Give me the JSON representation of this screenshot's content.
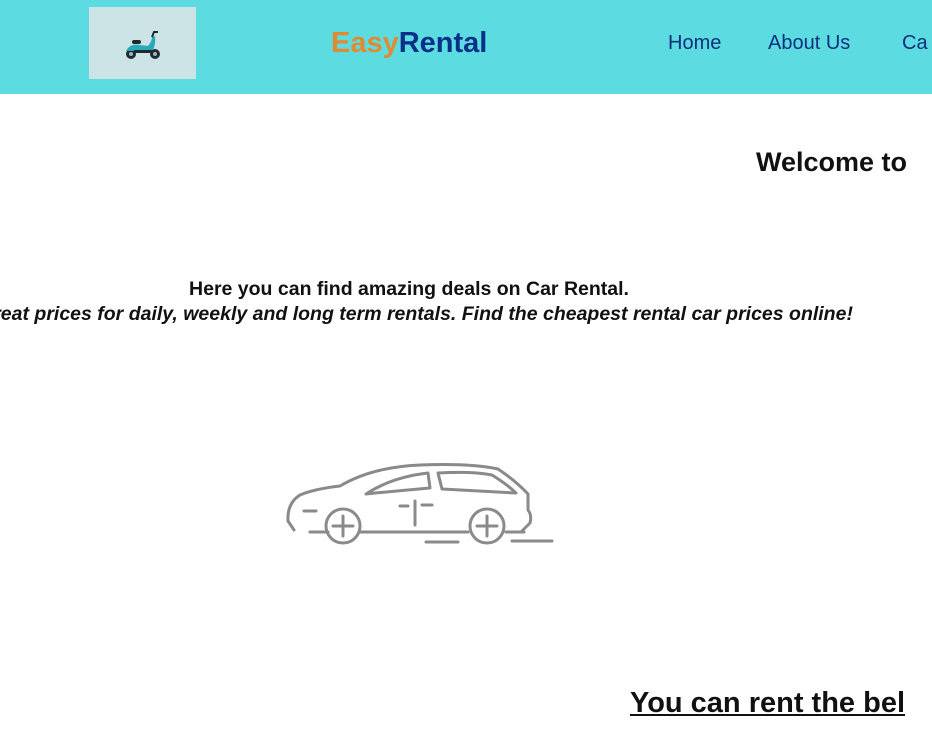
{
  "header": {
    "logo_icon": "scooter-icon",
    "brand_part1": "Easy",
    "brand_part2": "Rental",
    "colors": {
      "header_bg": "#5cdce0",
      "brand_easy": "#e08a32",
      "brand_rental": "#0a2f86",
      "nav_text": "#10307e"
    },
    "nav": [
      {
        "label": "Home"
      },
      {
        "label": "About Us"
      },
      {
        "label": "Ca"
      }
    ]
  },
  "main": {
    "welcome_heading": "Welcome to",
    "intro_line": "Here you can find amazing deals on Car Rental.",
    "intro_detail": "e great prices for daily, weekly and long term rentals. Find the cheapest rental car prices online!",
    "car_illustration": "car-icon",
    "rent_heading": "You can rent the bel"
  }
}
